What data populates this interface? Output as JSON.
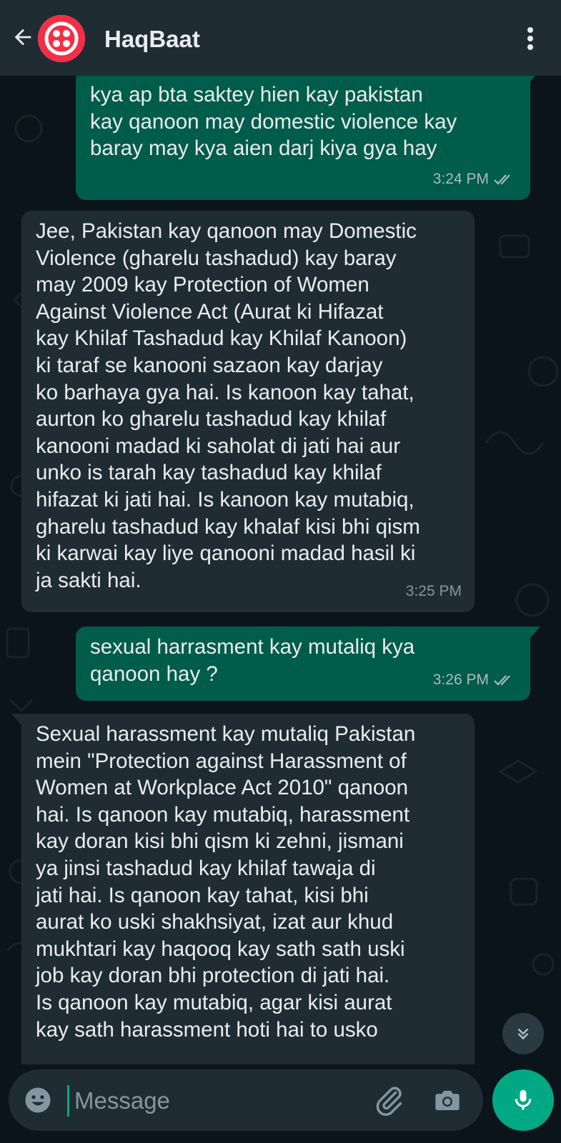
{
  "header": {
    "title": "HaqBaat",
    "back_icon": "arrow-left-icon",
    "avatar_icon": "twilio-logo",
    "menu_icon": "more-vertical-icon"
  },
  "messages": [
    {
      "direction": "outgoing",
      "text": "kya ap bta saktey hien kay pakistan\nkay qanoon may domestic violence kay\nbaray may kya aien darj kiya gya hay",
      "time": "3:24 PM",
      "status": "read"
    },
    {
      "direction": "incoming",
      "text": "Jee, Pakistan kay qanoon may Domestic\nViolence (gharelu tashadud) kay baray\nmay 2009 kay Protection of Women\nAgainst Violence Act (Aurat ki Hifazat\nkay Khilaf Tashadud kay Khilaf Kanoon)\nki taraf se kanooni sazaon kay darjay\nko barhaya gya hai. Is kanoon kay tahat,\naurton ko gharelu tashadud kay khilaf\nkanooni madad ki saholat di jati hai aur\nunko is tarah kay tashadud kay khilaf\nhifazat ki jati hai. Is kanoon kay mutabiq,\ngharelu tashadud kay khalaf kisi bhi qism\nki karwai kay liye qanooni madad hasil ki\nja sakti hai.",
      "time": "3:25 PM"
    },
    {
      "direction": "outgoing",
      "text": "sexual harrasment kay mutaliq kya\nqanoon hay ?",
      "time": "3:26 PM",
      "status": "read"
    },
    {
      "direction": "incoming",
      "text": "Sexual harassment kay mutaliq Pakistan\nmein \"Protection against Harassment of\nWomen at Workplace Act 2010\" qanoon\nhai. Is qanoon kay mutabiq, harassment\nkay doran kisi bhi qism ki zehni, jismani\nya jinsi tashadud kay khilaf tawaja di\njati hai. Is qanoon kay tahat, kisi bhi\naurat ko uski shakhsiyat, izat aur khud\nmukhtari kay haqooq kay sath sath uski\njob kay doran bhi protection di jati hai.\nIs qanoon kay mutabiq, agar kisi aurat\nkay sath harassment hoti hai to usko",
      "time": ""
    }
  ],
  "composer": {
    "placeholder": "Message",
    "value": "",
    "emoji_icon": "emoji-icon",
    "attach_icon": "paperclip-icon",
    "camera_icon": "camera-icon",
    "mic_icon": "microphone-icon"
  },
  "scroll_button_icon": "double-chevron-down-icon",
  "colors": {
    "background": "#0b141a",
    "header": "#1f2c34",
    "outgoing_bubble": "#005c4b",
    "incoming_bubble": "#1f2c34",
    "accent": "#00a884",
    "avatar_red": "#f22f46"
  }
}
